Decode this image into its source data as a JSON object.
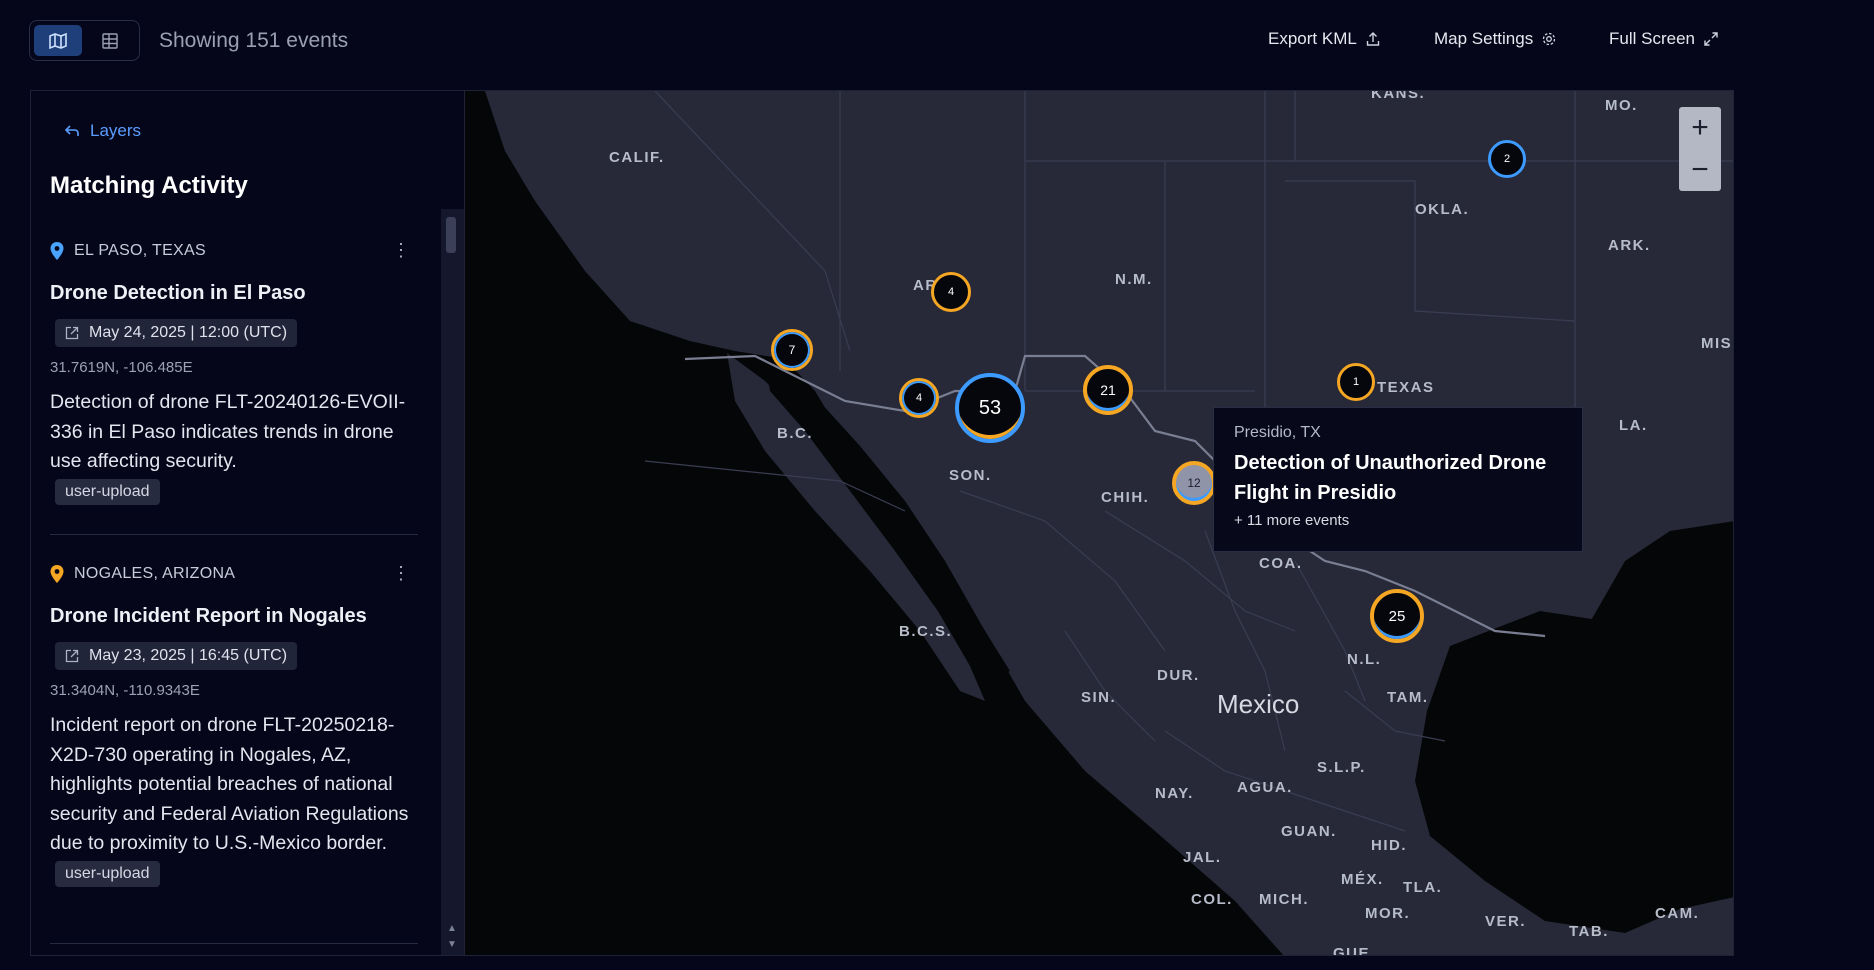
{
  "header": {
    "event_count": "Showing 151 events",
    "export_label": "Export KML",
    "settings_label": "Map Settings",
    "fullscreen_label": "Full Screen"
  },
  "sidebar": {
    "back_label": "Layers",
    "title": "Matching Activity",
    "cards": [
      {
        "location": "EL PASO, TEXAS",
        "pin_color": "#4aa3ff",
        "title": "Drone Detection in El Paso",
        "date": "May 24, 2025 | 12:00 (UTC)",
        "coords": "31.7619N, -106.485E",
        "description": "Detection of drone FLT-20240126-EVOII-336 in El Paso indicates trends in drone use affecting security.",
        "tag": "user-upload"
      },
      {
        "location": "NOGALES, ARIZONA",
        "pin_color": "#f5a623",
        "title": "Drone Incident Report in Nogales",
        "date": "May 23, 2025 | 16:45 (UTC)",
        "coords": "31.3404N, -110.9343E",
        "description": "Incident report on drone FLT-20250218-X2D-730 operating in Nogales, AZ, highlights potential breaches of national security and Federal Aviation Regulations due to proximity to U.S.-Mexico border.",
        "tag": "user-upload"
      }
    ]
  },
  "map": {
    "labels": [
      "CALIF.",
      "KANS.",
      "MO.",
      "OKLA.",
      "ARK.",
      "AR",
      "N.M.",
      "MIS",
      "TEXAS",
      "LA.",
      "B.C.",
      "SON.",
      "CHIH.",
      "COA.",
      "B.C.S.",
      "DUR.",
      "N.L.",
      "TAM.",
      "SIN.",
      "Mexico",
      "S.L.P.",
      "NAY.",
      "AGUA.",
      "GUAN.",
      "HID.",
      "JAL.",
      "MÉX.",
      "TLA.",
      "COL.",
      "MICH.",
      "MOR.",
      "VER.",
      "TAB.",
      "CAM.",
      "GUE."
    ],
    "clusters": [
      "2",
      "4",
      "7",
      "4",
      "53",
      "21",
      "1",
      "12",
      "25"
    ],
    "zoom_in": "+",
    "zoom_out": "−",
    "tooltip": {
      "location": "Presidio, TX",
      "title": "Detection of Unauthorized Drone Flight in Presidio",
      "more": "+ 11 more events"
    },
    "colors": {
      "blue_ring": "#3d9bff",
      "orange_ring": "#f5a623",
      "land": "#2a2c3b",
      "sea": "#050608"
    }
  }
}
